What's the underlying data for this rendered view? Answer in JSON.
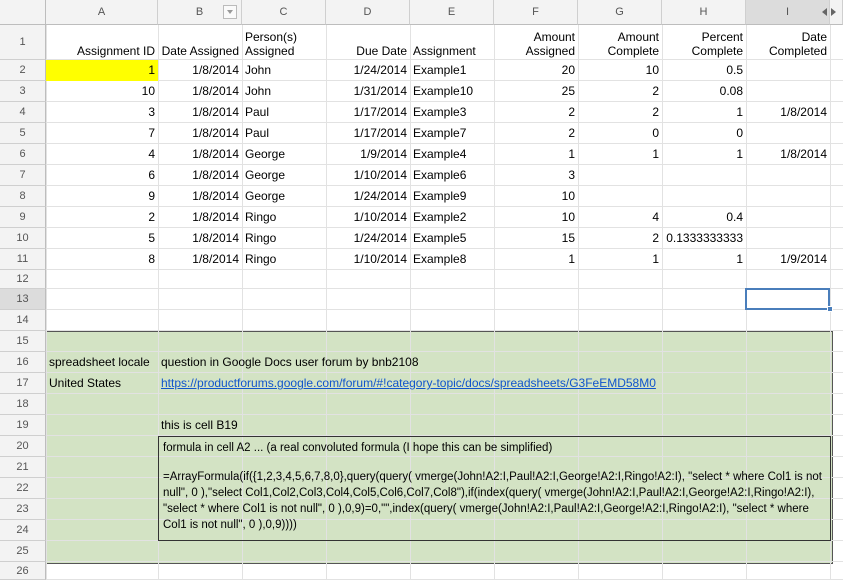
{
  "columns": [
    "A",
    "B",
    "C",
    "D",
    "E",
    "F",
    "G",
    "H",
    "I"
  ],
  "header_row": {
    "row_number": "1",
    "A": "Assignment ID",
    "B": "Date Assigned",
    "C": "Person(s) Assigned",
    "D": "Due Date",
    "E": "Assignment",
    "F": "Amount Assigned",
    "G": "Amount Complete",
    "H": "Percent Complete",
    "I": "Date Completed"
  },
  "rows": [
    {
      "n": "2",
      "A": "1",
      "B": "1/8/2014",
      "C": "John",
      "D": "1/24/2014",
      "E": "Example1",
      "F": "20",
      "G": "10",
      "H": "0.5",
      "I": ""
    },
    {
      "n": "3",
      "A": "10",
      "B": "1/8/2014",
      "C": "John",
      "D": "1/31/2014",
      "E": "Example10",
      "F": "25",
      "G": "2",
      "H": "0.08",
      "I": ""
    },
    {
      "n": "4",
      "A": "3",
      "B": "1/8/2014",
      "C": "Paul",
      "D": "1/17/2014",
      "E": "Example3",
      "F": "2",
      "G": "2",
      "H": "1",
      "I": "1/8/2014"
    },
    {
      "n": "5",
      "A": "7",
      "B": "1/8/2014",
      "C": "Paul",
      "D": "1/17/2014",
      "E": "Example7",
      "F": "2",
      "G": "0",
      "H": "0",
      "I": ""
    },
    {
      "n": "6",
      "A": "4",
      "B": "1/8/2014",
      "C": "George",
      "D": "1/9/2014",
      "E": "Example4",
      "F": "1",
      "G": "1",
      "H": "1",
      "I": "1/8/2014"
    },
    {
      "n": "7",
      "A": "6",
      "B": "1/8/2014",
      "C": "George",
      "D": "1/10/2014",
      "E": "Example6",
      "F": "3",
      "G": "",
      "H": "",
      "I": ""
    },
    {
      "n": "8",
      "A": "9",
      "B": "1/8/2014",
      "C": "George",
      "D": "1/24/2014",
      "E": "Example9",
      "F": "10",
      "G": "",
      "H": "",
      "I": ""
    },
    {
      "n": "9",
      "A": "2",
      "B": "1/8/2014",
      "C": "Ringo",
      "D": "1/10/2014",
      "E": "Example2",
      "F": "10",
      "G": "4",
      "H": "0.4",
      "I": ""
    },
    {
      "n": "10",
      "A": "5",
      "B": "1/8/2014",
      "C": "Ringo",
      "D": "1/24/2014",
      "E": "Example5",
      "F": "15",
      "G": "2",
      "H": "0.1333333333",
      "I": ""
    },
    {
      "n": "11",
      "A": "8",
      "B": "1/8/2014",
      "C": "Ringo",
      "D": "1/10/2014",
      "E": "Example8",
      "F": "1",
      "G": "1",
      "H": "1",
      "I": "1/9/2014"
    }
  ],
  "empty_row_numbers": [
    "12",
    "13",
    "14",
    "15",
    "16",
    "17",
    "18",
    "19",
    "20",
    "21",
    "22",
    "23",
    "24",
    "25",
    "26"
  ],
  "notes": {
    "locale_label": "spreadsheet locale",
    "locale_value": "United States",
    "question": "question in Google Docs user forum by bnb2108",
    "link": "https://productforums.google.com/forum/#!category-topic/docs/spreadsheets/G3FeEMD58M0",
    "cell_b19": "this is cell B19",
    "formula_intro": "formula in cell A2 ... (a real convoluted formula (I hope this can be simplified)",
    "formula": "=ArrayFormula(if({1,2,3,4,5,6,7,8,0},query(query( vmerge(John!A2:I,Paul!A2:I,George!A2:I,Ringo!A2:I), \"select * where Col1 is not null\", 0 ),\"select Col1,Col2,Col3,Col4,Col5,Col6,Col7,Col8\"),if(index(query( vmerge(John!A2:I,Paul!A2:I,George!A2:I,Ringo!A2:I), \"select * where Col1 is not null\", 0 ),0,9)=0,\"\",index(query( vmerge(John!A2:I,Paul!A2:I,George!A2:I,Ringo!A2:I), \"select * where Col1 is not null\", 0 ),0,9))))"
  },
  "colors": {
    "highlight_yellow": "#ffff00",
    "note_green": "#d3e3c4",
    "selection_blue": "#4a7ebb",
    "link_blue": "#1155cc"
  },
  "selected_cell": "I13",
  "icons": {
    "filter": "filter-dropdown-icon",
    "scroll": "column-scroll-arrows-icon"
  }
}
